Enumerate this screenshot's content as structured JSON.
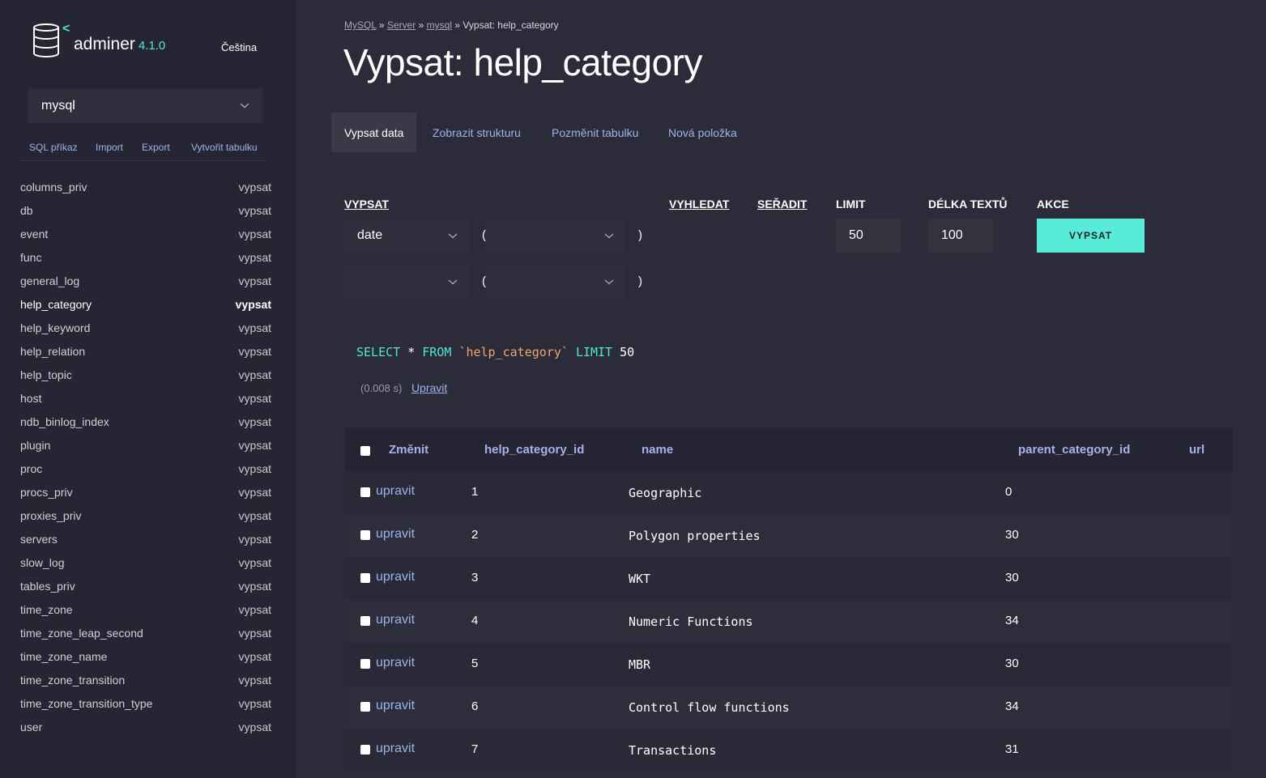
{
  "app": {
    "name": "adminer",
    "version": "4.1.0",
    "language": "Čeština"
  },
  "sidebar": {
    "db_selected": "mysql",
    "links": [
      "SQL příkaz",
      "Import",
      "Export",
      "Vytvořit tabulku"
    ],
    "select_label": "vypsat",
    "tables": [
      "columns_priv",
      "db",
      "event",
      "func",
      "general_log",
      "help_category",
      "help_keyword",
      "help_relation",
      "help_topic",
      "host",
      "ndb_binlog_index",
      "plugin",
      "proc",
      "procs_priv",
      "proxies_priv",
      "servers",
      "slow_log",
      "tables_priv",
      "time_zone",
      "time_zone_leap_second",
      "time_zone_name",
      "time_zone_transition",
      "time_zone_transition_type",
      "user"
    ],
    "active_table": "help_category"
  },
  "breadcrumb": {
    "items": [
      "MySQL",
      "Server",
      "mysql"
    ],
    "sep": "»",
    "current": "Vypsat: help_category"
  },
  "page_title": "Vypsat: help_category",
  "tabs": [
    "Vypsat data",
    "Zobrazit strukturu",
    "Pozměnit tabulku",
    "Nová položka"
  ],
  "form": {
    "headers": {
      "select": "VYPSAT",
      "search": "VYHLEDAT",
      "sort": "SEŘADIT",
      "limit": "LIMIT",
      "text_length": "DÉLKA TEXTŮ",
      "action": "AKCE"
    },
    "select_row1": {
      "column": "date",
      "open_paren": "(",
      "close_paren": ")"
    },
    "select_row2": {
      "column": "",
      "open_paren": "(",
      "close_paren": ")"
    },
    "limit": "50",
    "text_length": "100",
    "submit": "VYPSAT"
  },
  "query": {
    "kw1": "SELECT",
    "star": "*",
    "kw2": "FROM",
    "table": "`help_category`",
    "kw3": "LIMIT",
    "limit": "50",
    "time": "(0.008 s)",
    "edit": "Upravit"
  },
  "result": {
    "columns": [
      "Změnit",
      "help_category_id",
      "name",
      "parent_category_id",
      "url"
    ],
    "edit_label": "upravit",
    "rows": [
      {
        "id": "1",
        "name": "Geographic",
        "parent": "0"
      },
      {
        "id": "2",
        "name": "Polygon properties",
        "parent": "30"
      },
      {
        "id": "3",
        "name": "WKT",
        "parent": "30"
      },
      {
        "id": "4",
        "name": "Numeric Functions",
        "parent": "34"
      },
      {
        "id": "5",
        "name": "MBR",
        "parent": "30"
      },
      {
        "id": "6",
        "name": "Control flow functions",
        "parent": "34"
      },
      {
        "id": "7",
        "name": "Transactions",
        "parent": "31"
      }
    ]
  },
  "colors": {
    "accent": "#56ecd8",
    "link": "#9cb4ea",
    "sql_keyword": "#4ee8d4",
    "sql_string": "#f0a86a"
  }
}
